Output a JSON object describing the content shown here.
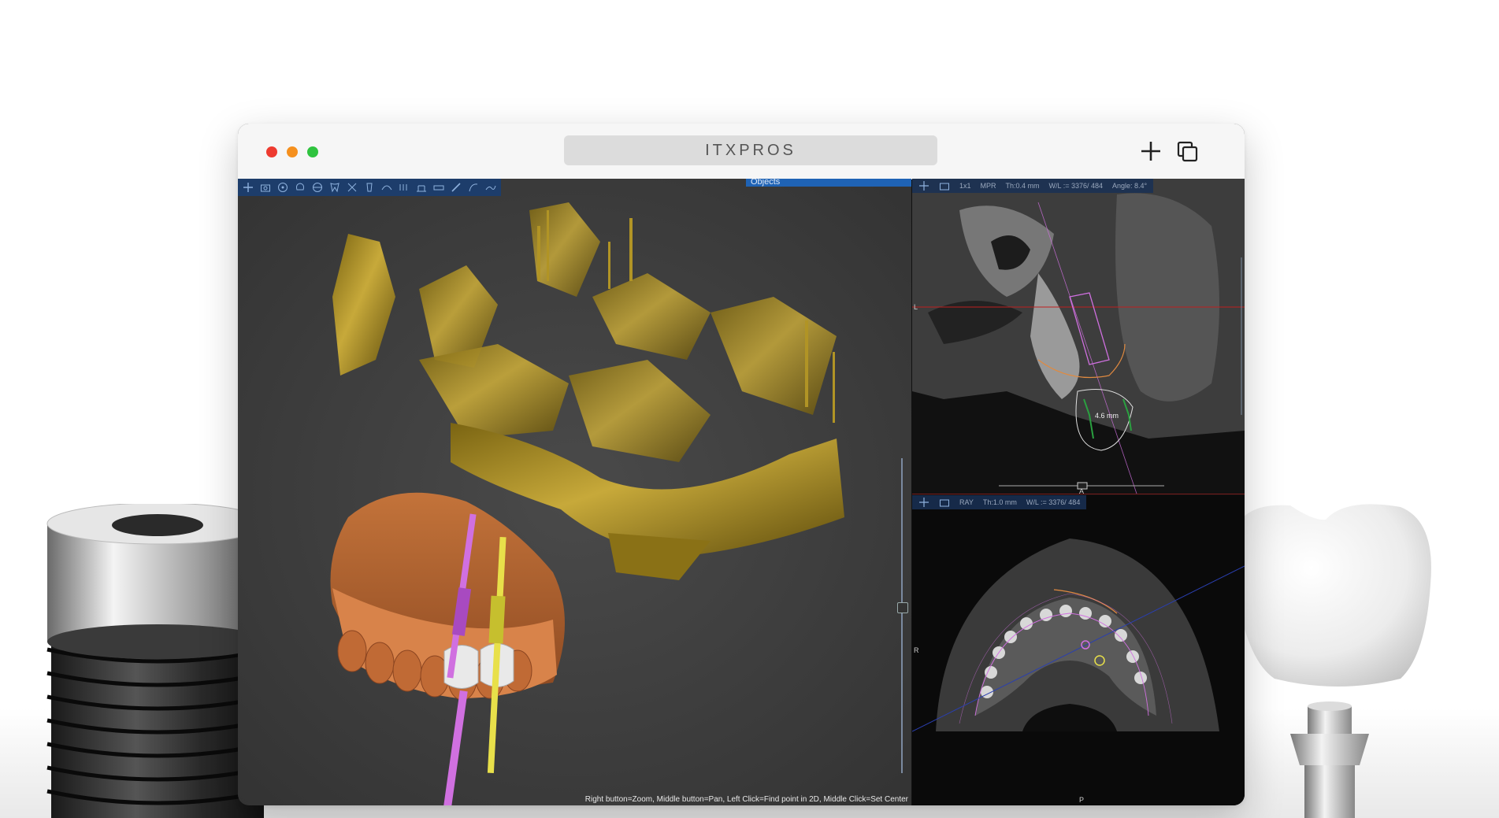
{
  "window": {
    "url": "ITXPROS",
    "traffic_lights": [
      "#ee3b30",
      "#f5901e",
      "#2fc33f"
    ],
    "actions": [
      "plus-icon",
      "duplicate-icon"
    ]
  },
  "viewer3d": {
    "toolbar_icons": [
      "move-icon",
      "camera-icon",
      "radiation-icon",
      "skull-icon",
      "globe-icon",
      "tooth-icon",
      "cross-icon",
      "implant-icon",
      "nerve-icon",
      "teeth-row-icon",
      "abutment-icon",
      "ruler-icon",
      "pen-icon",
      "curve-icon",
      "spline-icon"
    ],
    "objects_tab": "Objects",
    "status_hint": "Right button=Zoom, Middle button=Pan, Left Click=Find point in 2D, Middle Click=Set Center",
    "implant_colors": [
      "#d070e0",
      "#e8e04a"
    ]
  },
  "mpr_top": {
    "layout": "1x1",
    "mode": "MPR",
    "thickness": "Th:0.4 mm",
    "window_level": "W/L := 3376/ 484",
    "angle": "Angle: 8.4°",
    "left_label": "L",
    "bottom_label": "A",
    "measurement": "4.6 mm"
  },
  "mpr_bottom": {
    "mode": "RAY",
    "thickness": "Th:1.0 mm",
    "window_level": "W/L := 3376/ 484",
    "left_label": "R",
    "bottom_label": "P"
  },
  "colors": {
    "bone": "#b89a2a",
    "gum": "#d07a40",
    "toolbar": "#1d3d6b",
    "crosshair_red": "#c02020",
    "crosshair_blue": "#2a3fb0"
  }
}
